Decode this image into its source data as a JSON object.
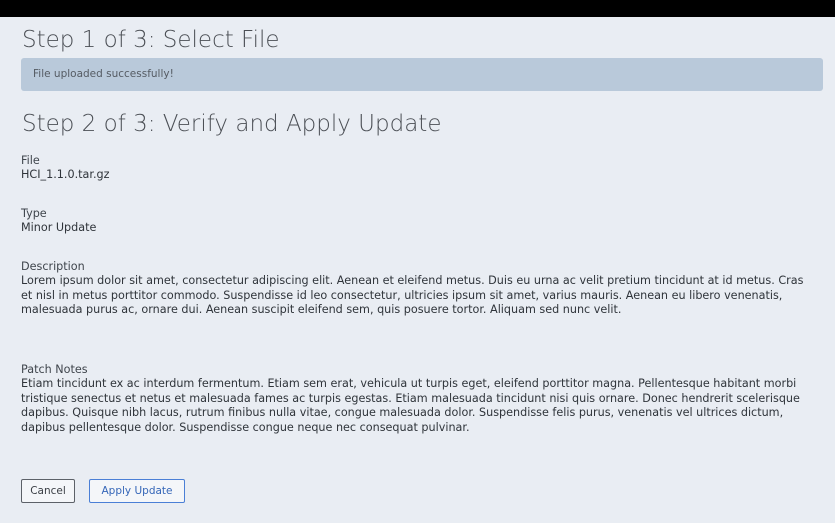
{
  "step1": {
    "title": "Step 1 of 3: Select File",
    "status_message": "File uploaded successfully!"
  },
  "step2": {
    "title": "Step 2 of 3: Verify and Apply Update",
    "file": {
      "label": "File",
      "value": "HCI_1.1.0.tar.gz"
    },
    "type": {
      "label": "Type",
      "value": "Minor Update"
    },
    "description": {
      "label": "Description",
      "value": "Lorem ipsum dolor sit amet, consectetur adipiscing elit. Aenean et eleifend metus. Duis eu urna ac velit pretium tincidunt at id metus. Cras et nisl in metus porttitor commodo. Suspendisse id leo consectetur, ultricies ipsum sit amet, varius mauris. Aenean eu libero venenatis, malesuada purus ac, ornare dui. Aenean suscipit eleifend sem, quis posuere tortor. Aliquam sed nunc velit."
    },
    "patch_notes": {
      "label": "Patch Notes",
      "value": "Etiam tincidunt ex ac interdum fermentum. Etiam sem erat, vehicula ut turpis eget, eleifend porttitor magna. Pellentesque habitant morbi tristique senectus et netus et malesuada fames ac turpis egestas. Etiam malesuada tincidunt nisi quis ornare. Donec hendrerit scelerisque dapibus. Quisque nibh lacus, rutrum finibus nulla vitae, congue malesuada dolor. Suspendisse felis purus, venenatis vel ultrices dictum, dapibus pellentesque dolor. Suspendisse congue neque nec consequat pulvinar."
    }
  },
  "actions": {
    "cancel_label": "Cancel",
    "apply_label": "Apply Update"
  }
}
